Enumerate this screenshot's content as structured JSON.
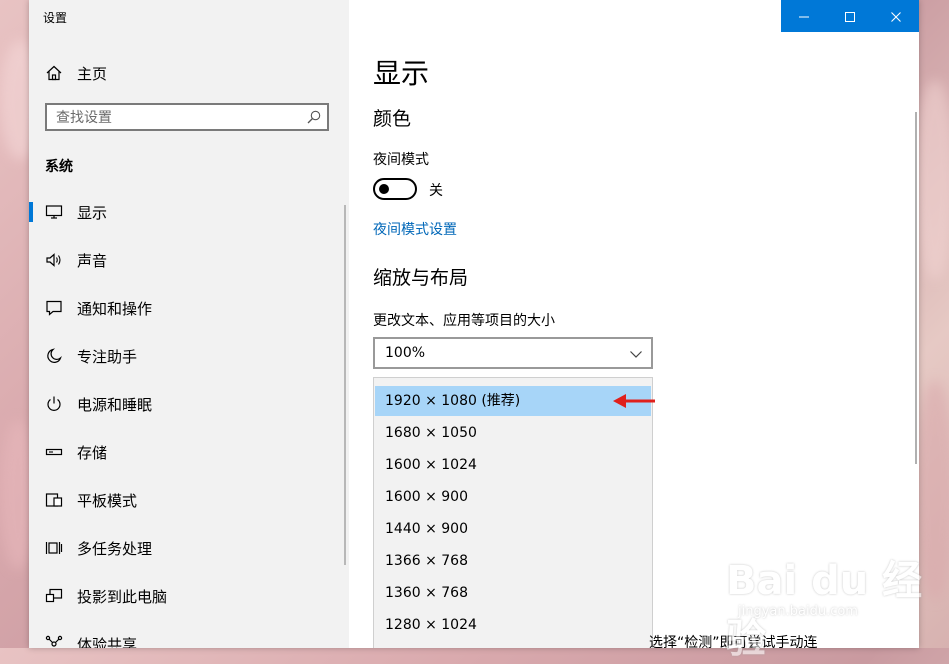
{
  "app": {
    "title": "设置",
    "controls": {
      "minimize": "minimize-icon",
      "maximize": "maximize-icon",
      "close": "close-icon"
    }
  },
  "sidebar": {
    "home_label": "主页",
    "search_placeholder": "查找设置",
    "section": "系统",
    "items": [
      {
        "label": "显示",
        "icon": "monitor-icon",
        "active": true
      },
      {
        "label": "声音",
        "icon": "speaker-icon"
      },
      {
        "label": "通知和操作",
        "icon": "notification-icon"
      },
      {
        "label": "专注助手",
        "icon": "moon-icon"
      },
      {
        "label": "电源和睡眠",
        "icon": "power-icon"
      },
      {
        "label": "存储",
        "icon": "storage-icon"
      },
      {
        "label": "平板模式",
        "icon": "tablet-icon"
      },
      {
        "label": "多任务处理",
        "icon": "multitask-icon"
      },
      {
        "label": "投影到此电脑",
        "icon": "project-icon"
      },
      {
        "label": "体验共享",
        "icon": "share-icon"
      }
    ]
  },
  "main": {
    "page_title": "显示",
    "color_heading": "颜色",
    "night_mode_label": "夜间模式",
    "night_mode_state": "关",
    "night_mode_settings_link": "夜间模式设置",
    "scale_heading": "缩放与布局",
    "scale_label": "更改文本、应用等项目的大小",
    "scale_value": "100%",
    "resolutions": [
      "1920 × 1080 (推荐)",
      "1680 × 1050",
      "1600 × 1024",
      "1600 × 900",
      "1440 × 900",
      "1366 × 768",
      "1360 × 768",
      "1280 × 1024"
    ],
    "selected_resolution": "1920 × 1080 (推荐)",
    "detect_text": "选择“检测”即可尝试手动连"
  },
  "watermark": {
    "line1": "Bai du 经验",
    "line2": "jingyan.baidu.com"
  },
  "colors": {
    "accent": "#0078d7",
    "link": "#0067b8",
    "selected": "#a7d5f8",
    "arrow": "#e0201c"
  }
}
